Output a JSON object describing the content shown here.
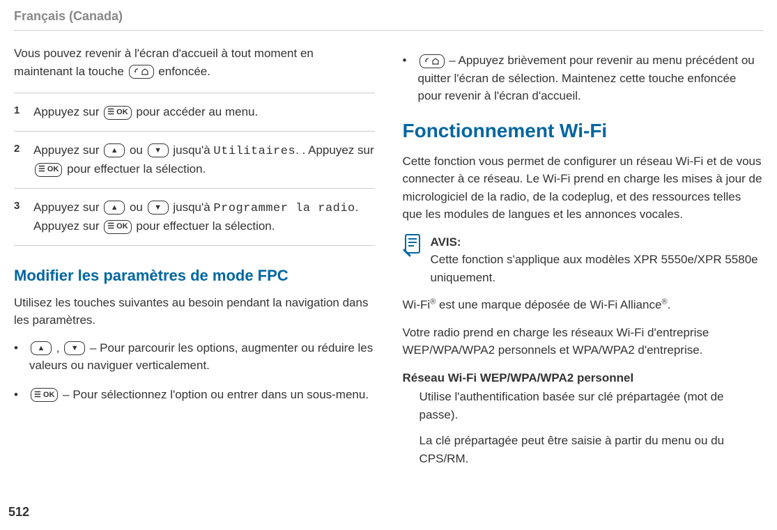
{
  "header": {
    "lang": "Français (Canada)"
  },
  "left": {
    "intro_1a": "Vous pouvez revenir à l'écran d'accueil à tout moment en maintenant la touche ",
    "intro_1b": " enfoncée.",
    "steps": [
      {
        "num": "1",
        "p1a": "Appuyez sur ",
        "p1b": " pour accéder au menu."
      },
      {
        "num": "2",
        "p1a": "Appuyez sur ",
        "p1b": " ou ",
        "p1c": " jusqu'à ",
        "code1": "Utilitaires",
        "p1d": ". Appuyez sur ",
        "p1e": " pour effectuer la sélection."
      },
      {
        "num": "3",
        "p1a": "Appuyez sur ",
        "p1b": " ou ",
        "p1c": " jusqu'à ",
        "code1": "Programmer la radio",
        "p1d": ". Appuyez sur ",
        "p1e": " pour effectuer la sélection."
      }
    ],
    "subheading": "Modifier les paramètres de mode FPC",
    "subpara": "Utilisez les touches suivantes au besoin pendant la navigation dans les paramètres.",
    "bullets": [
      {
        "pre": "",
        "sep": " , ",
        "post": " – Pour parcourir les options, augmenter ou réduire les valeurs ou naviguer verticalement."
      },
      {
        "pre": "",
        "post": " – Pour sélectionnez l'option ou entrer dans un sous-menu."
      }
    ]
  },
  "right": {
    "bullet_back": " – Appuyez brièvement pour revenir au menu précédent ou quitter l'écran de sélection. Maintenez cette touche enfoncée pour revenir à l'écran d'accueil.",
    "mainheading": "Fonctionnement Wi-Fi",
    "para1": "Cette fonction vous permet de configurer un réseau Wi-Fi et de vous connecter à ce réseau. Le Wi-Fi prend en charge les mises à jour de micrologiciel de la radio, de la codeplug, et des ressources telles que les modules de langues et les annonces vocales.",
    "note_title": "AVIS:",
    "note_body": "Cette fonction s'applique aux modèles XPR 5550e/XPR 5580e uniquement.",
    "para2": "Wi-Fi® est une marque déposée de Wi-Fi Alliance®.",
    "para3": "Votre radio prend en charge les réseaux Wi-Fi d'entreprise WEP/WPA/WPA2 personnels et WPA/WPA2 d'entreprise.",
    "def_title": "Réseau Wi-Fi WEP/WPA/WPA2 personnel",
    "def_body1": "Utilise l'authentification basée sur clé prépartagée (mot de passe).",
    "def_body2": "La clé prépartagée peut être saisie à partir du menu ou du CPS/RM."
  },
  "page_num": "512"
}
